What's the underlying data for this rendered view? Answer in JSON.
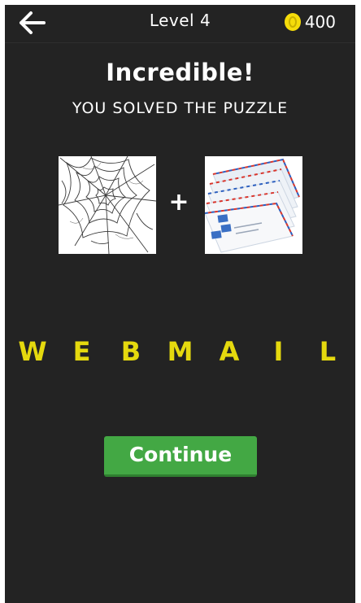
{
  "header": {
    "level_label": "Level 4",
    "coin_count": "400",
    "back_icon": "arrow-left-icon",
    "coin_icon": "coin-icon"
  },
  "result": {
    "headline": "Incredible!",
    "subline": "YOU SOLVED THE PUZZLE"
  },
  "clues": {
    "left_image": "spider-web",
    "right_image": "stack-of-airmail-envelopes",
    "plus": "+"
  },
  "answer": {
    "letters": [
      "W",
      "E",
      "B",
      "M",
      "A",
      "I",
      "L"
    ]
  },
  "actions": {
    "continue_label": "Continue"
  },
  "colors": {
    "background": "#232323",
    "answer_letters": "#e5d90e",
    "continue_button": "#43a844",
    "coin": "#f5dc0a"
  }
}
